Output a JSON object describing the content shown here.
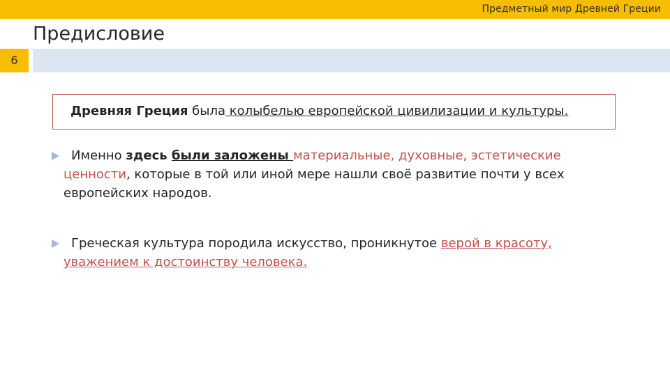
{
  "header": {
    "title": "Предметный мир Древней Греции"
  },
  "slide": {
    "title": "Предисловие",
    "number": "6"
  },
  "quote": {
    "part1": "Древняя Греция",
    "part2": " была",
    "part3": " колыбелью европейской цивилизации и культуры."
  },
  "bullets": [
    {
      "t1": "Именно ",
      "t2": "здесь ",
      "t3": "были заложены ",
      "t4": "материальные, духовные, эстетические",
      "t5": "ценности",
      "t6": ", которые в той или иной мере нашли своё развитие почти у всех европейских народов."
    },
    {
      "t1": "Греческая культура породила искусство, проникнутое ",
      "t2": "верой в красоту, ",
      "t3": "уважением к достоинству человека."
    }
  ],
  "colors": {
    "accent_yellow": "#f7bd00",
    "band_blue": "#dce6f2",
    "highlight_red": "#c0504d"
  }
}
